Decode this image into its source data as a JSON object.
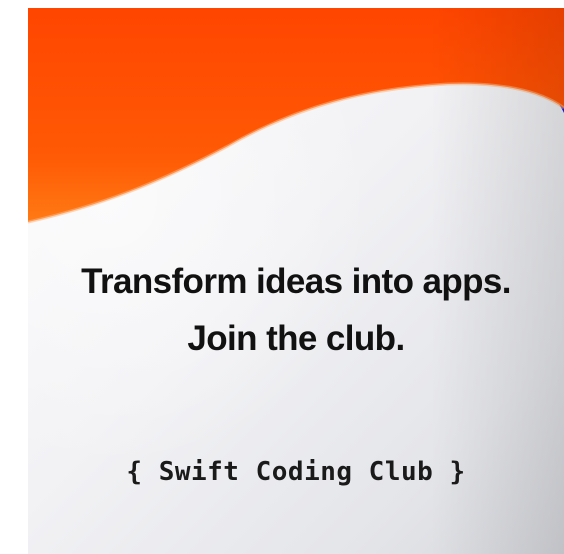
{
  "poster": {
    "headline_line1": "Transform ideas into apps.",
    "headline_line2": "Join the club.",
    "club": {
      "open_brace": "{",
      "name": "Swift Coding Club",
      "close_brace": "}"
    }
  },
  "colors": {
    "orange_top": "#ff4a00",
    "orange_mid": "#ff6a0a",
    "accent_blue": "#1f18d6",
    "background_light": "#f4f4f7",
    "background_shade": "#d9dadf",
    "headline_text": "#111111"
  }
}
